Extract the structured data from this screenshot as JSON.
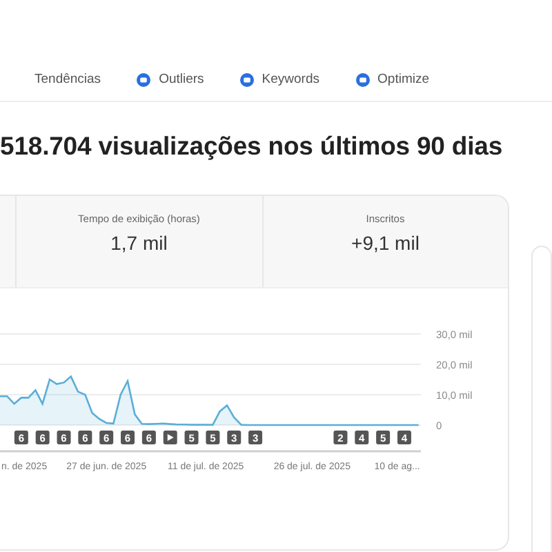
{
  "nav": {
    "items": [
      {
        "label": "Tendências",
        "icon": false
      },
      {
        "label": "Outliers",
        "icon": true
      },
      {
        "label": "Keywords",
        "icon": true
      },
      {
        "label": "Optimize",
        "icon": true
      }
    ]
  },
  "heading": "518.704 visualizações nos últimos 90 dias",
  "metrics": [
    {
      "label": "Tempo de exibição (horas)",
      "value": "1,7 mil"
    },
    {
      "label": "Inscritos",
      "value": "+9,1 mil"
    }
  ],
  "chart": {
    "chart_data": {
      "type": "area",
      "categories": [
        null,
        null,
        null,
        "n. de 2025",
        null,
        null,
        null,
        null,
        null,
        null,
        null,
        null,
        null,
        null,
        null,
        "27 de jun. de 2025",
        null,
        null,
        null,
        null,
        null,
        null,
        null,
        null,
        null,
        null,
        null,
        null,
        null,
        "11 de jul. de 2025",
        null,
        null,
        null,
        null,
        null,
        null,
        null,
        null,
        null,
        null,
        null,
        null,
        null,
        null,
        "26 de jul. de 2025",
        null,
        null,
        null,
        null,
        null,
        null,
        null,
        null,
        null,
        null,
        null,
        "10 de ag...",
        null,
        null,
        null
      ],
      "series": [
        {
          "color": "#5aaed8",
          "values": [
            9.5,
            9.5,
            7,
            9,
            9,
            11.5,
            7,
            15,
            13.5,
            14,
            16,
            11,
            10,
            4,
            2,
            0.7,
            0.5,
            10,
            14.5,
            3.5,
            0.4,
            0.3,
            0.4,
            0.5,
            0.3,
            0.2,
            0.2,
            0.1,
            0.1,
            0.1,
            0.1,
            4.5,
            6.5,
            2.5,
            0.1,
            0,
            0,
            0,
            0,
            0,
            0,
            0,
            0,
            0,
            0,
            0,
            0,
            0,
            0,
            0,
            0,
            0,
            0,
            0,
            0,
            0,
            0,
            0,
            0,
            0
          ]
        }
      ],
      "ylim": [
        0,
        30
      ],
      "yticks": [
        {
          "value": 0,
          "label": "0"
        },
        {
          "value": 10,
          "label": "10,0 mil"
        },
        {
          "value": 20,
          "label": "20,0 mil"
        },
        {
          "value": 30,
          "label": "30,0 mil"
        }
      ]
    },
    "markers": [
      {
        "kind": "count",
        "label": "6"
      },
      {
        "kind": "count",
        "label": "6"
      },
      {
        "kind": "count",
        "label": "6"
      },
      {
        "kind": "count",
        "label": "6"
      },
      {
        "kind": "count",
        "label": "6"
      },
      {
        "kind": "count",
        "label": "6"
      },
      {
        "kind": "count",
        "label": "6"
      },
      {
        "kind": "play"
      },
      {
        "kind": "count",
        "label": "5"
      },
      {
        "kind": "count",
        "label": "5"
      },
      {
        "kind": "count",
        "label": "3"
      },
      {
        "kind": "count",
        "label": "3"
      },
      {
        "kind": "none"
      },
      {
        "kind": "none"
      },
      {
        "kind": "none"
      },
      {
        "kind": "count",
        "label": "2"
      },
      {
        "kind": "count",
        "label": "4"
      },
      {
        "kind": "count",
        "label": "5"
      },
      {
        "kind": "count",
        "label": "4"
      }
    ]
  }
}
